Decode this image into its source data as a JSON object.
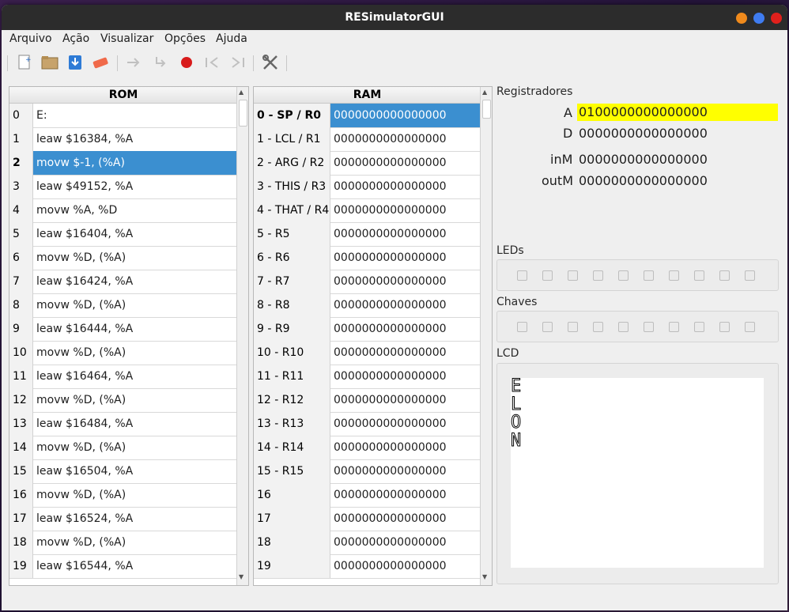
{
  "window": {
    "title": "RESimulatorGUI"
  },
  "menu": [
    "Arquivo",
    "Ação",
    "Visualizar",
    "Opções",
    "Ajuda"
  ],
  "toolbar": [
    "new-file-icon",
    "open-folder-icon",
    "save-download-icon",
    "eraser-icon",
    "step-icon",
    "step-into-icon",
    "stop-icon",
    "rewind-start-icon",
    "forward-end-icon",
    "tools-icon"
  ],
  "rom": {
    "header": "ROM",
    "rows": [
      {
        "addr": "0",
        "instr": "E:"
      },
      {
        "addr": "1",
        "instr": "leaw $16384, %A"
      },
      {
        "addr": "2",
        "instr": "movw $-1, (%A)"
      },
      {
        "addr": "3",
        "instr": "leaw $49152, %A"
      },
      {
        "addr": "4",
        "instr": "movw %A, %D"
      },
      {
        "addr": "5",
        "instr": "leaw $16404, %A"
      },
      {
        "addr": "6",
        "instr": "movw %D, (%A)"
      },
      {
        "addr": "7",
        "instr": "leaw $16424, %A"
      },
      {
        "addr": "8",
        "instr": "movw %D, (%A)"
      },
      {
        "addr": "9",
        "instr": "leaw $16444, %A"
      },
      {
        "addr": "10",
        "instr": "movw %D, (%A)"
      },
      {
        "addr": "11",
        "instr": "leaw $16464, %A"
      },
      {
        "addr": "12",
        "instr": "movw %D, (%A)"
      },
      {
        "addr": "13",
        "instr": "leaw $16484, %A"
      },
      {
        "addr": "14",
        "instr": "movw %D, (%A)"
      },
      {
        "addr": "15",
        "instr": "leaw $16504, %A"
      },
      {
        "addr": "16",
        "instr": "movw %D, (%A)"
      },
      {
        "addr": "17",
        "instr": "leaw $16524, %A"
      },
      {
        "addr": "18",
        "instr": "movw %D, (%A)"
      },
      {
        "addr": "19",
        "instr": "leaw $16544, %A"
      }
    ],
    "selected_row": 2
  },
  "ram": {
    "header": "RAM",
    "rows": [
      {
        "addr": "0 - SP / R0",
        "value": "0000000000000000"
      },
      {
        "addr": "1 - LCL / R1",
        "value": "0000000000000000"
      },
      {
        "addr": "2 - ARG / R2",
        "value": "0000000000000000"
      },
      {
        "addr": "3 - THIS / R3",
        "value": "0000000000000000"
      },
      {
        "addr": "4 - THAT / R4",
        "value": "0000000000000000"
      },
      {
        "addr": "5 - R5",
        "value": "0000000000000000"
      },
      {
        "addr": "6 - R6",
        "value": "0000000000000000"
      },
      {
        "addr": "7 - R7",
        "value": "0000000000000000"
      },
      {
        "addr": "8 - R8",
        "value": "0000000000000000"
      },
      {
        "addr": "9 - R9",
        "value": "0000000000000000"
      },
      {
        "addr": "10 - R10",
        "value": "0000000000000000"
      },
      {
        "addr": "11 - R11",
        "value": "0000000000000000"
      },
      {
        "addr": "12 - R12",
        "value": "0000000000000000"
      },
      {
        "addr": "13 - R13",
        "value": "0000000000000000"
      },
      {
        "addr": "14 - R14",
        "value": "0000000000000000"
      },
      {
        "addr": "15 - R15",
        "value": "0000000000000000"
      },
      {
        "addr": "16",
        "value": "0000000000000000"
      },
      {
        "addr": "17",
        "value": "0000000000000000"
      },
      {
        "addr": "18",
        "value": "0000000000000000"
      },
      {
        "addr": "19",
        "value": "0000000000000000"
      }
    ],
    "selected_row": 0
  },
  "registers": {
    "title": "Registradores",
    "A": {
      "label": "A",
      "value": "0100000000000000",
      "highlight": "#ffff00"
    },
    "D": {
      "label": "D",
      "value": "0000000000000000"
    },
    "inM": {
      "label": "inM",
      "value": "0000000000000000"
    },
    "outM": {
      "label": "outM",
      "value": "0000000000000000"
    }
  },
  "leds": {
    "title": "LEDs",
    "count": 10
  },
  "chaves": {
    "title": "Chaves",
    "count": 10
  },
  "lcd": {
    "title": "LCD",
    "text": [
      "E",
      "L",
      "O",
      "N"
    ]
  },
  "colors": {
    "selection": "#3b8fd0",
    "register_highlight": "#ffff00",
    "close": "#e0201c",
    "maximize": "#3f7cf0",
    "minimize": "#f08a1c"
  }
}
